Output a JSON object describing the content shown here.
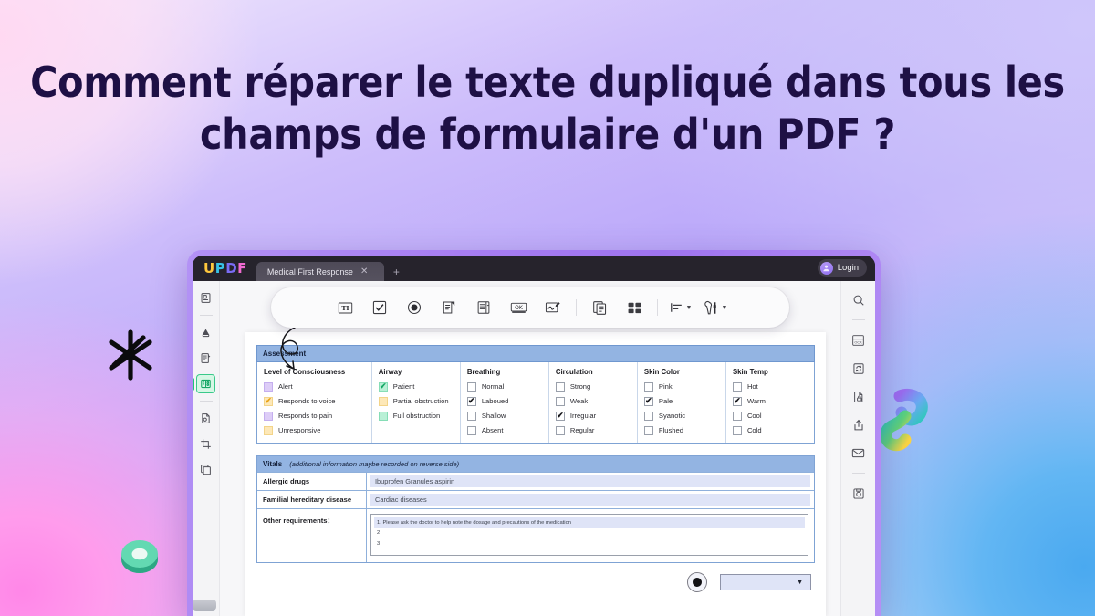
{
  "hero": {
    "title": "Comment réparer le texte dupliqué dans tous les champs de formulaire d'un PDF ?"
  },
  "app": {
    "logo_parts": [
      "U",
      "P",
      "D",
      "F"
    ],
    "tab_title": "Medical First Response",
    "tab_close": "✕",
    "tab_new": "+",
    "login_label": "Login"
  },
  "toolbar": {
    "items": [
      {
        "name": "text-field-tool",
        "glyph": "TI"
      },
      {
        "name": "checkbox-tool",
        "glyph": "checkbox"
      },
      {
        "name": "radio-button-tool",
        "glyph": "radio"
      },
      {
        "name": "dropdown-tool",
        "glyph": "dropdown"
      },
      {
        "name": "list-box-tool",
        "glyph": "listbox"
      },
      {
        "name": "push-button-tool",
        "glyph": "OK"
      },
      {
        "name": "signature-tool",
        "glyph": "signature"
      },
      {
        "name": "duplicate-fields-tool",
        "glyph": "copy"
      },
      {
        "name": "arrange-fields-tool",
        "glyph": "grid"
      },
      {
        "name": "align-tool",
        "glyph": "align"
      },
      {
        "name": "field-settings-tool",
        "glyph": "tools"
      }
    ]
  },
  "left_rail": {
    "items": [
      {
        "name": "thumbnails",
        "active": false
      },
      {
        "name": "annotate-highlight",
        "active": false
      },
      {
        "name": "edit-pdf",
        "active": false
      },
      {
        "name": "prepare-form",
        "active": true
      },
      {
        "name": "page-organize",
        "active": false
      },
      {
        "name": "crop-page",
        "active": false
      },
      {
        "name": "compare-files",
        "active": false
      }
    ]
  },
  "right_rail": {
    "items": [
      {
        "name": "search",
        "glyph": "search"
      },
      {
        "name": "ocr",
        "glyph": "OCR"
      },
      {
        "name": "convert",
        "glyph": "convert"
      },
      {
        "name": "protect",
        "glyph": "lock"
      },
      {
        "name": "share",
        "glyph": "share"
      },
      {
        "name": "email",
        "glyph": "mail"
      },
      {
        "name": "save",
        "glyph": "save"
      }
    ]
  },
  "form": {
    "assessment": {
      "section_title": "Assessment",
      "columns": [
        {
          "title": "Level of Consciousness",
          "options": [
            {
              "label": "Alert",
              "style": "purple",
              "checked": false
            },
            {
              "label": "Responds to voice",
              "style": "yellow",
              "checked": true
            },
            {
              "label": "Responds to pain",
              "style": "purple",
              "checked": false
            },
            {
              "label": "Unresponsive",
              "style": "yellow",
              "checked": false
            }
          ]
        },
        {
          "title": "Airway",
          "options": [
            {
              "label": "Patient",
              "style": "green",
              "checked": true
            },
            {
              "label": "Partial obstruction",
              "style": "yellow",
              "checked": false
            },
            {
              "label": "Full obstruction",
              "style": "green",
              "checked": false
            }
          ]
        },
        {
          "title": "Breathing",
          "options": [
            {
              "label": "Normal",
              "style": "plain",
              "checked": false
            },
            {
              "label": "Laboued",
              "style": "plain",
              "checked": true
            },
            {
              "label": "Shallow",
              "style": "plain",
              "checked": false
            },
            {
              "label": "Absent",
              "style": "plain",
              "checked": false
            }
          ]
        },
        {
          "title": "Circulation",
          "options": [
            {
              "label": "Strong",
              "style": "plain",
              "checked": false
            },
            {
              "label": "Weak",
              "style": "plain",
              "checked": false
            },
            {
              "label": "Irregular",
              "style": "plain",
              "checked": true
            },
            {
              "label": "Regular",
              "style": "plain",
              "checked": false
            }
          ]
        },
        {
          "title": "Skin Color",
          "options": [
            {
              "label": "Pink",
              "style": "plain",
              "checked": false
            },
            {
              "label": "Pale",
              "style": "plain",
              "checked": true
            },
            {
              "label": "Syanotic",
              "style": "plain",
              "checked": false
            },
            {
              "label": "Flushed",
              "style": "plain",
              "checked": false
            }
          ]
        },
        {
          "title": "Skin Temp",
          "options": [
            {
              "label": "Hot",
              "style": "plain",
              "checked": false
            },
            {
              "label": "Warm",
              "style": "plain",
              "checked": true
            },
            {
              "label": "Cool",
              "style": "plain",
              "checked": false
            },
            {
              "label": "Cold",
              "style": "plain",
              "checked": false
            }
          ]
        }
      ]
    },
    "vitals": {
      "section_title": "Vitals",
      "section_note": "(additional information maybe recorded on reverse side)",
      "rows": [
        {
          "label": "Allergic drugs",
          "value": "Ibuprofen Granules  aspirin"
        },
        {
          "label": "Familial hereditary disease",
          "value": "Cardiac diseases"
        }
      ],
      "other": {
        "label": "Other requirements：",
        "lines": [
          "1. Please ask the doctor to help note the dosage and precautions of the medication",
          "2",
          "3"
        ]
      }
    },
    "widgets": {
      "radio_name": "radio-button-field",
      "dropdown_name": "dropdown-field",
      "dropdown_caret": "▼"
    }
  },
  "colors": {
    "accent_green": "#20c479",
    "section_blue": "#93b4e2",
    "field_fill": "#dfe4f7",
    "title_ink": "#1e1045"
  }
}
